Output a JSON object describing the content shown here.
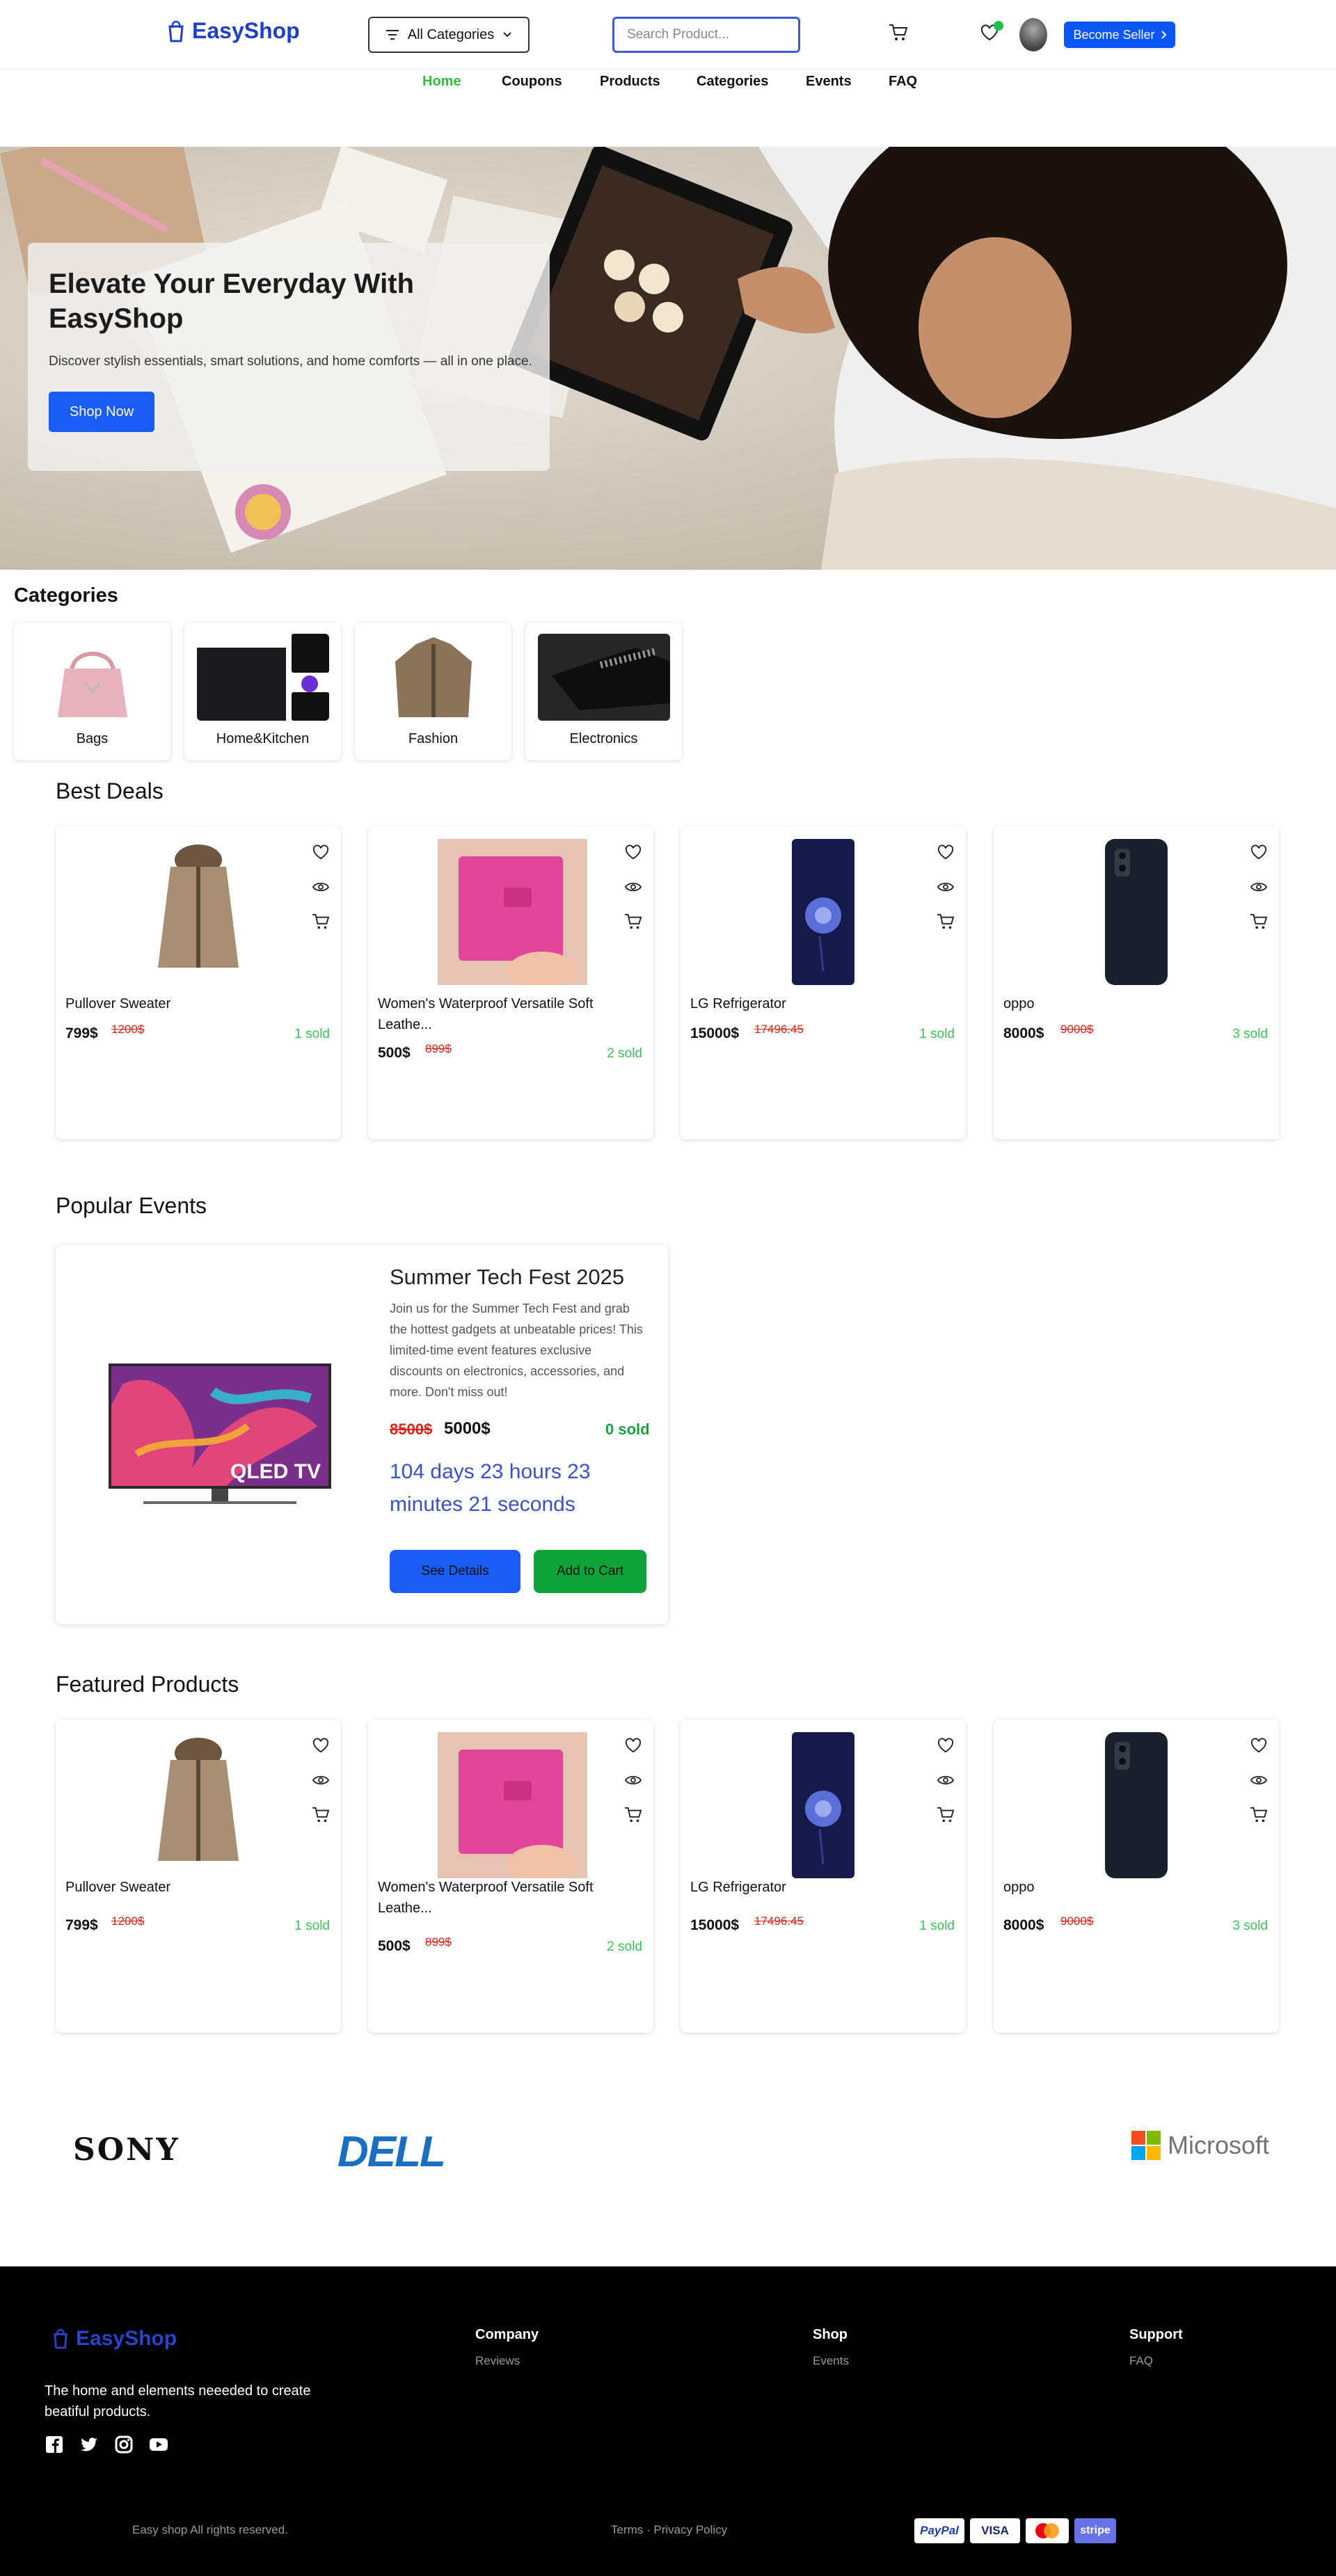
{
  "header": {
    "logo_text": "EasyShop",
    "all_categories_label": "All Categories",
    "search_placeholder": "Search Product...",
    "become_seller_label": "Become Seller",
    "cart_icon": "cart-icon",
    "wishlist_icon": "heart-icon"
  },
  "nav": {
    "items": [
      {
        "label": "Home",
        "active": true
      },
      {
        "label": "Coupons"
      },
      {
        "label": "Products"
      },
      {
        "label": "Categories"
      },
      {
        "label": "Events"
      },
      {
        "label": "FAQ"
      }
    ]
  },
  "hero": {
    "title": "Elevate Your Everyday With EasyShop",
    "description": "Discover stylish essentials, smart solutions, and home comforts — all in one place.",
    "button_label": "Shop Now"
  },
  "categories": {
    "title": "Categories",
    "items": [
      {
        "label": "Bags"
      },
      {
        "label": "Home&Kitchen"
      },
      {
        "label": "Fashion"
      },
      {
        "label": "Electronics"
      }
    ]
  },
  "best_deals": {
    "title": "Best Deals",
    "products": [
      {
        "name": "Pullover Sweater",
        "price": "799$",
        "old_price": "1200$",
        "sold": "1 sold"
      },
      {
        "name": "Women's Waterproof Versatile Soft Leathe...",
        "price": "500$",
        "old_price": "899$",
        "sold": "2 sold"
      },
      {
        "name": "LG Refrigerator",
        "price": "15000$",
        "old_price": "17496.45",
        "sold": "1 sold"
      },
      {
        "name": "oppo",
        "price": "8000$",
        "old_price": "9000$",
        "sold": "3 sold"
      }
    ]
  },
  "events": {
    "title": "Popular Events",
    "event": {
      "name": "Summer Tech Fest 2025",
      "description": "Join us for the Summer Tech Fest and grab the hottest gadgets at unbeatable prices! This limited-time event features exclusive discounts on electronics, accessories, and more. Don't miss out!",
      "old_price": "8500$",
      "price": "5000$",
      "sold": "0 sold",
      "countdown": "104 days 23 hours 23 minutes 21 seconds",
      "details_label": "See Details",
      "cart_label": "Add to Cart",
      "image_text": "QLED TV"
    }
  },
  "featured": {
    "title": "Featured Products",
    "products": [
      {
        "name": "Pullover Sweater",
        "price": "799$",
        "old_price": "1200$",
        "sold": "1 sold"
      },
      {
        "name": "Women's Waterproof Versatile Soft Leathe...",
        "price": "500$",
        "old_price": "899$",
        "sold": "2 sold"
      },
      {
        "name": "LG Refrigerator",
        "price": "15000$",
        "old_price": "17496.45",
        "sold": "1 sold"
      },
      {
        "name": "oppo",
        "price": "8000$",
        "old_price": "9000$",
        "sold": "3 sold"
      }
    ]
  },
  "brands": [
    "SONY",
    "DELL",
    "Microsoft"
  ],
  "footer": {
    "logo_text": "EasyShop",
    "tagline": "The home and elements neeeded to create beatiful products.",
    "columns": [
      {
        "heading": "Company",
        "links": [
          "Reviews"
        ]
      },
      {
        "heading": "Shop",
        "links": [
          "Events"
        ]
      },
      {
        "heading": "Support",
        "links": [
          "FAQ"
        ]
      }
    ],
    "copyright": "Easy shop All rights reserved.",
    "legal": "Terms · Privacy Policy",
    "payments": [
      "PayPal",
      "VISA",
      "mastercard",
      "stripe"
    ]
  },
  "colors": {
    "brand": "#1f3fc7",
    "primary_button": "#1a5cf5",
    "success": "#1aa23f",
    "old_price": "#d9261c",
    "nav_active": "#2ebd3c"
  }
}
